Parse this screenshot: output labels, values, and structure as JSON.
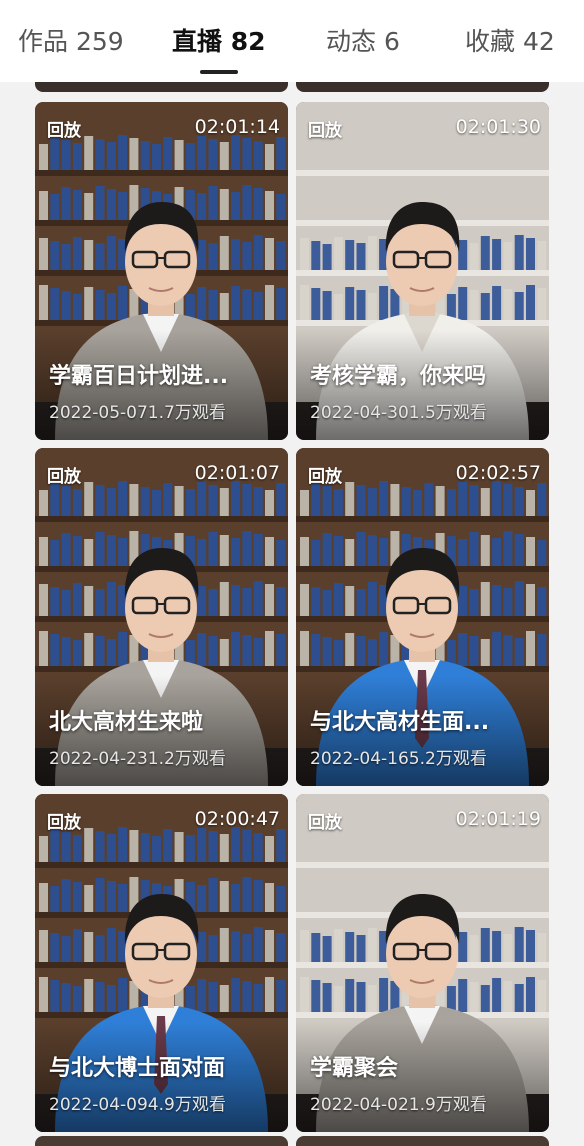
{
  "tabs": [
    {
      "label": "作品 259",
      "active": false
    },
    {
      "label": "直播 82",
      "active": true
    },
    {
      "label": "动态 6",
      "active": false
    },
    {
      "label": "收藏 42",
      "active": false
    }
  ],
  "cards": [
    {
      "badge": "回放",
      "duration": "02:01:14",
      "title": "学霸百日计划进...",
      "meta": "2022-05-071.7万观看",
      "suit": "gray",
      "shelf": "blue"
    },
    {
      "badge": "回放",
      "duration": "02:01:30",
      "title": "考核学霸，你来吗",
      "meta": "2022-04-301.5万观看",
      "suit": "white",
      "shelf": "light"
    },
    {
      "badge": "回放",
      "duration": "02:01:07",
      "title": "北大高材生来啦",
      "meta": "2022-04-231.2万观看",
      "suit": "gray",
      "shelf": "wood"
    },
    {
      "badge": "回放",
      "duration": "02:02:57",
      "title": "与北大高材生面...",
      "meta": "2022-04-165.2万观看",
      "suit": "blue",
      "shelf": "wood"
    },
    {
      "badge": "回放",
      "duration": "02:00:47",
      "title": "与北大博士面对面",
      "meta": "2022-04-094.9万观看",
      "suit": "blue",
      "shelf": "wood"
    },
    {
      "badge": "回放",
      "duration": "02:01:19",
      "title": "学霸聚会",
      "meta": "2022-04-021.9万观看",
      "suit": "gray",
      "shelf": "light"
    }
  ],
  "colors": {
    "tab_active": "#111111",
    "tab_inactive": "#555555",
    "suit_gray": "#a8a39c",
    "suit_blue": "#2f7fd8",
    "suit_white": "#f1efea",
    "shelf_wood": "#5a3f2c",
    "book_blue": "#2d4f8f"
  }
}
